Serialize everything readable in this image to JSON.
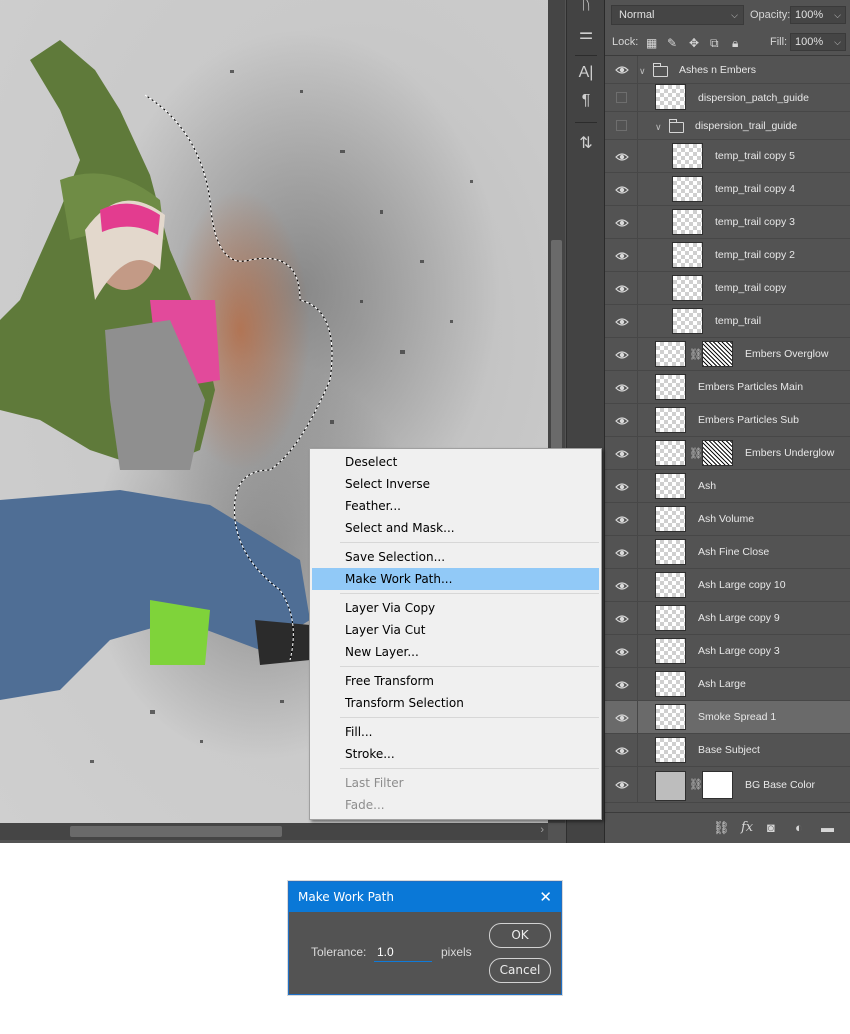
{
  "layers_panel": {
    "blend_mode": "Normal",
    "opacity_label": "Opacity:",
    "opacity_value": "100%",
    "lock_label": "Lock:",
    "fill_label": "Fill:",
    "fill_value": "100%",
    "layers": [
      {
        "name": "Ashes n Embers",
        "visible": true,
        "kind": "group"
      },
      {
        "name": "dispersion_patch_guide",
        "visible": false,
        "kind": "layer"
      },
      {
        "name": "dispersion_trail_guide",
        "visible": false,
        "kind": "group"
      },
      {
        "name": "temp_trail copy 5",
        "visible": true,
        "kind": "layer"
      },
      {
        "name": "temp_trail copy 4",
        "visible": true,
        "kind": "layer"
      },
      {
        "name": "temp_trail copy 3",
        "visible": true,
        "kind": "layer"
      },
      {
        "name": "temp_trail copy 2",
        "visible": true,
        "kind": "layer"
      },
      {
        "name": "temp_trail copy",
        "visible": true,
        "kind": "layer"
      },
      {
        "name": "temp_trail",
        "visible": true,
        "kind": "layer"
      },
      {
        "name": "Embers Overglow",
        "visible": true,
        "kind": "masked"
      },
      {
        "name": "Embers Particles Main",
        "visible": true,
        "kind": "layer"
      },
      {
        "name": "Embers Particles Sub",
        "visible": true,
        "kind": "layer"
      },
      {
        "name": "Embers Underglow",
        "visible": true,
        "kind": "masked"
      },
      {
        "name": "Ash",
        "visible": true,
        "kind": "layer"
      },
      {
        "name": "Ash Volume",
        "visible": true,
        "kind": "layer"
      },
      {
        "name": "Ash Fine Close",
        "visible": true,
        "kind": "layer"
      },
      {
        "name": "Ash Large copy 10",
        "visible": true,
        "kind": "layer"
      },
      {
        "name": "Ash Large copy 9",
        "visible": true,
        "kind": "layer"
      },
      {
        "name": "Ash Large copy 3",
        "visible": true,
        "kind": "layer"
      },
      {
        "name": "Ash Large",
        "visible": true,
        "kind": "layer"
      },
      {
        "name": "Smoke Spread 1",
        "visible": true,
        "kind": "layer",
        "selected": true
      },
      {
        "name": "Base Subject",
        "visible": true,
        "kind": "layer"
      },
      {
        "name": "BG Base Color",
        "visible": true,
        "kind": "masked"
      }
    ],
    "footer_icons": [
      "link-icon",
      "fx-icon",
      "mask-icon",
      "adjustment-icon",
      "folder-icon"
    ]
  },
  "context_menu": {
    "items": [
      {
        "label": "Deselect"
      },
      {
        "label": "Select Inverse"
      },
      {
        "label": "Feather..."
      },
      {
        "label": "Select and Mask..."
      },
      {
        "sep": true
      },
      {
        "label": "Save Selection..."
      },
      {
        "label": "Make Work Path...",
        "highlighted": true
      },
      {
        "sep": true
      },
      {
        "label": "Layer Via Copy"
      },
      {
        "label": "Layer Via Cut"
      },
      {
        "label": "New Layer..."
      },
      {
        "sep": true
      },
      {
        "label": "Free Transform"
      },
      {
        "label": "Transform Selection"
      },
      {
        "sep": true
      },
      {
        "label": "Fill..."
      },
      {
        "label": "Stroke..."
      },
      {
        "sep": true
      },
      {
        "label": "Last Filter",
        "disabled": true
      },
      {
        "label": "Fade...",
        "disabled": true
      }
    ]
  },
  "dialog": {
    "title": "Make Work Path",
    "close_glyph": "✕",
    "tolerance_label": "Tolerance:",
    "tolerance_value": "1.0",
    "unit": "pixels",
    "ok_label": "OK",
    "cancel_label": "Cancel"
  },
  "colors": {
    "menu_highlight": "#91c9f7",
    "dialog_title_bar": "#0a78d7",
    "panel_bg": "#535353"
  }
}
